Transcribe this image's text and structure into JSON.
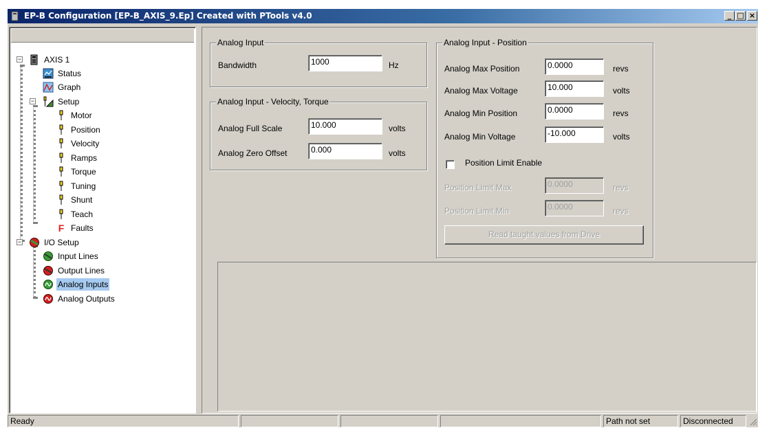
{
  "window": {
    "title": "EP-B Configuration  [EP-B_AXIS_9.Ep] Created with PTools v4.0",
    "minimize_glyph": "_",
    "maximize_glyph": "□",
    "close_glyph": "×"
  },
  "tree": {
    "items": [
      {
        "label": "AXIS 1",
        "icon": "drive-icon"
      },
      {
        "label": "Status",
        "icon": "status-icon"
      },
      {
        "label": "Graph",
        "icon": "graph-icon"
      },
      {
        "label": "Setup",
        "icon": "setup-icon"
      },
      {
        "label": "Motor",
        "icon": "pin-icon"
      },
      {
        "label": "Position",
        "icon": "pin-icon"
      },
      {
        "label": "Velocity",
        "icon": "pin-icon"
      },
      {
        "label": "Ramps",
        "icon": "pin-icon"
      },
      {
        "label": "Torque",
        "icon": "pin-icon"
      },
      {
        "label": "Tuning",
        "icon": "pin-icon"
      },
      {
        "label": "Shunt",
        "icon": "pin-icon"
      },
      {
        "label": "Teach",
        "icon": "pin-icon"
      },
      {
        "label": "Faults",
        "icon": "faults-icon"
      },
      {
        "label": "I/O Setup",
        "icon": "io-icon"
      },
      {
        "label": "Input Lines",
        "icon": "input-lines-icon"
      },
      {
        "label": "Output Lines",
        "icon": "output-lines-icon"
      },
      {
        "label": "Analog Inputs",
        "icon": "analog-inputs-icon",
        "selected": true
      },
      {
        "label": "Analog Outputs",
        "icon": "analog-outputs-icon"
      }
    ],
    "faults_glyph": "F",
    "expander_glyph": "−"
  },
  "analog_input": {
    "title": "Analog Input",
    "bandwidth_label": "Bandwidth",
    "bandwidth_value": "1000",
    "bandwidth_unit": "Hz"
  },
  "velocity_torque": {
    "title": "Analog Input - Velocity, Torque",
    "full_scale_label": "Analog Full Scale",
    "full_scale_value": "10.000",
    "full_scale_unit": "volts",
    "zero_offset_label": "Analog Zero Offset",
    "zero_offset_value": "0.000",
    "zero_offset_unit": "volts"
  },
  "position": {
    "title": "Analog Input - Position",
    "max_position_label": "Analog Max Position",
    "max_position_value": "0.0000",
    "max_position_unit": "revs",
    "max_voltage_label": "Analog Max Voltage",
    "max_voltage_value": "10.000",
    "max_voltage_unit": "volts",
    "min_position_label": "Analog Min Position",
    "min_position_value": "0.0000",
    "min_position_unit": "revs",
    "min_voltage_label": "Analog Min Voltage",
    "min_voltage_value": "-10.000",
    "min_voltage_unit": "volts",
    "limit_enable_label": "Position Limit Enable",
    "limit_enable_checked": false,
    "limit_max_label": "Position Limit Max",
    "limit_max_value": "0.0000",
    "limit_max_unit": "revs",
    "limit_min_label": "Position Limit Min",
    "limit_min_value": "0.0000",
    "limit_min_unit": "revs",
    "read_button_label": "Read taught values from Drive"
  },
  "statusbar": {
    "ready": "Ready",
    "path": "Path not set",
    "connection": "Disconnected"
  },
  "colors": {
    "face": "#d4d0c8",
    "title_start": "#0a246a",
    "title_end": "#a6caf0",
    "selection": "#a6caf0"
  }
}
